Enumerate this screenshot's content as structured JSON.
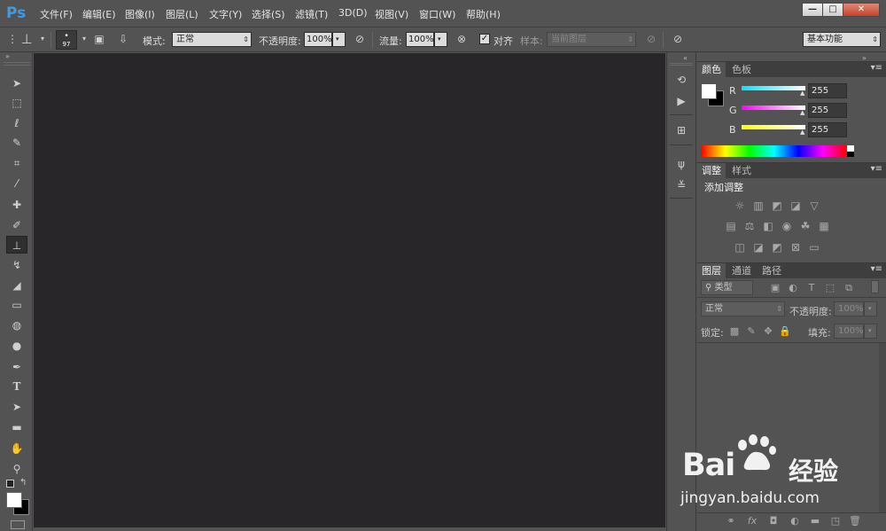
{
  "app": {
    "logo": "Ps"
  },
  "menu": [
    "文件(F)",
    "编辑(E)",
    "图像(I)",
    "图层(L)",
    "文字(Y)",
    "选择(S)",
    "滤镜(T)",
    "3D(D)",
    "视图(V)",
    "窗口(W)",
    "帮助(H)"
  ],
  "window_controls": {
    "minimize": "—",
    "maximize": "□",
    "close": "✕"
  },
  "options": {
    "brush_size": "97",
    "mode_label": "模式:",
    "mode_value": "正常",
    "opacity_label": "不透明度:",
    "opacity_value": "100%",
    "flow_label": "流量:",
    "flow_value": "100%",
    "align_label": "对齐",
    "sample_label": "样本:",
    "sample_value": "当前图层",
    "workspace": "基本功能"
  },
  "color_panel": {
    "tabs": [
      "颜色",
      "色板"
    ],
    "channels": [
      {
        "label": "R",
        "value": "255",
        "gradient": "#00e5ff"
      },
      {
        "label": "G",
        "value": "255",
        "gradient": "#ff00ff"
      },
      {
        "label": "B",
        "value": "255",
        "gradient": "#ffff00"
      }
    ]
  },
  "adjust_panel": {
    "tabs": [
      "调整",
      "样式"
    ],
    "heading": "添加调整"
  },
  "layers_panel": {
    "tabs": [
      "图层",
      "通道",
      "路径"
    ],
    "filter_value": "类型",
    "blend_value": "正常",
    "opacity_label": "不透明度:",
    "opacity_value": "100%",
    "lock_label": "锁定:",
    "fill_label": "填充:",
    "fill_value": "100%"
  },
  "watermark": {
    "brand": "Bai",
    "brand2": "经验",
    "url": "jingyan.baidu.com"
  }
}
